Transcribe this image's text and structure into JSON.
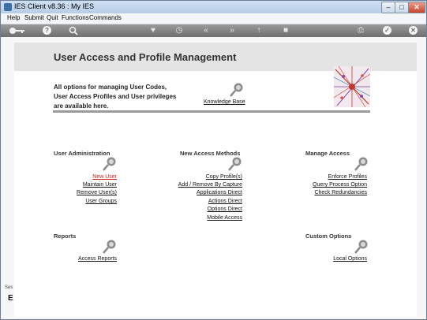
{
  "window": {
    "title": "IES Client v8.36 : My IES"
  },
  "menu": [
    "Help",
    "Submit",
    "Quit",
    "Functions",
    "Commands"
  ],
  "toolbar": {
    "icons": [
      "key-icon",
      "help-icon",
      "search-icon",
      "heart-icon",
      "history-icon",
      "rewind-icon",
      "forward-icon",
      "upload-icon",
      "stop-icon",
      "print-icon",
      "ok-icon",
      "close-icon"
    ]
  },
  "page": {
    "title": "User Access and Profile Management",
    "intro": "All options for managing User Codes, User Access Profiles and User privileges are available here.",
    "knowledge_base": "Knowledge Base"
  },
  "sections": {
    "user_admin": {
      "title": "User Administration",
      "links": [
        "New User",
        "Maintain User",
        "Remove User(s)",
        "User Groups"
      ]
    },
    "new_access": {
      "title": "New Access Methods",
      "links": [
        "Copy Profile(s)",
        "Add / Remove By Capture",
        "Applications Direct",
        "Actions Direct",
        "Options Direct",
        "Mobile Access"
      ]
    },
    "manage_access": {
      "title": "Manage Access",
      "links": [
        "Enforce Profiles",
        "Query Process Option",
        "Check Redundancies"
      ]
    },
    "reports": {
      "title": "Reports",
      "links": [
        "Access Reports"
      ]
    },
    "custom_options": {
      "title": "Custom Options",
      "links": [
        "Local Options"
      ]
    }
  },
  "side_panel": {
    "label": "Ses",
    "mark": "E"
  },
  "colors": {
    "active_link": "#d0201a",
    "toolbar": "#7f7f7f",
    "header_band": "#e4e4e4"
  }
}
